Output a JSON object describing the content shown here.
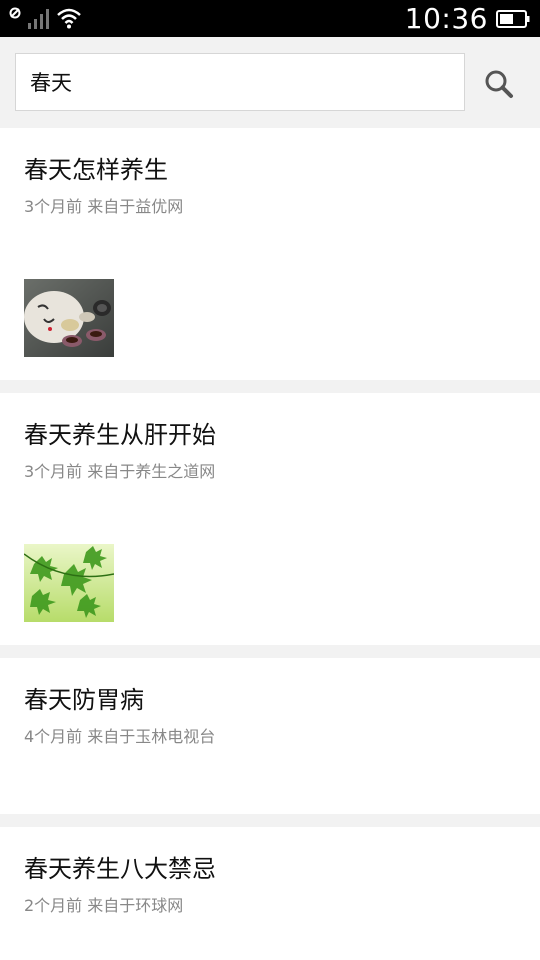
{
  "status_bar": {
    "time": "10:36",
    "icons": [
      "no-sim-icon",
      "signal-icon",
      "wifi-icon",
      "battery-icon"
    ]
  },
  "search": {
    "value": "春天",
    "button_icon": "search-icon"
  },
  "results": [
    {
      "title": "春天怎样养生",
      "meta": "3个月前 来自于益优网",
      "thumbnail": "tea-set-image"
    },
    {
      "title": "春天养生从肝开始",
      "meta": "3个月前 来自于养生之道网",
      "thumbnail": "green-leaves-image"
    },
    {
      "title": "春天防胃病",
      "meta": "4个月前 来自于玉林电视台"
    },
    {
      "title": "春天养生八大禁忌",
      "meta": "2个月前 来自于环球网"
    }
  ]
}
